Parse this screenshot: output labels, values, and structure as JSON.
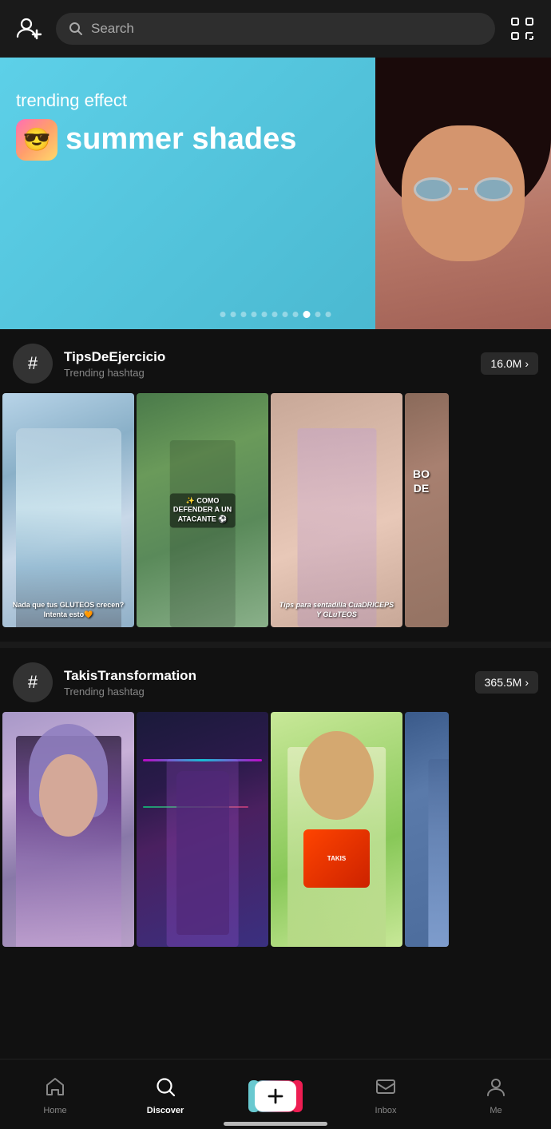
{
  "header": {
    "search_placeholder": "Search",
    "add_user_icon": "add-user-icon",
    "scan_icon": "scan-icon"
  },
  "banner": {
    "trending_label": "trending effect",
    "effect_name": "summer shades",
    "effect_icon_emoji": "😎",
    "dots_count": 11,
    "active_dot": 9
  },
  "hashtags": [
    {
      "name": "TipsDeEjercicio",
      "sub": "Trending hashtag",
      "count": "16.0M",
      "videos": [
        {
          "text": "Nada que tus GLUTEOS crecen? Intenta esto🧡",
          "color": "thumb-1"
        },
        {
          "text": "✨ COMO DEFENDER A UN ATACANTE ⚽",
          "color": "thumb-2"
        },
        {
          "text": "Tips para sentadilla CUaDRICEPS Y GLuTEOS",
          "color": "thumb-3"
        },
        {
          "text": "BO DE",
          "color": "thumb-4",
          "partial": true
        }
      ]
    },
    {
      "name": "TakisTransformation",
      "sub": "Trending hashtag",
      "count": "365.5M",
      "videos": [
        {
          "text": "",
          "color": "thumb-5"
        },
        {
          "text": "",
          "color": "thumb-6"
        },
        {
          "text": "",
          "color": "thumb-7"
        },
        {
          "text": "",
          "color": "thumb-8",
          "partial": true
        }
      ]
    }
  ],
  "nav": {
    "items": [
      {
        "id": "home",
        "label": "Home",
        "active": false
      },
      {
        "id": "discover",
        "label": "Discover",
        "active": true
      },
      {
        "id": "add",
        "label": "",
        "active": false
      },
      {
        "id": "inbox",
        "label": "Inbox",
        "active": false
      },
      {
        "id": "me",
        "label": "Me",
        "active": false
      }
    ]
  }
}
